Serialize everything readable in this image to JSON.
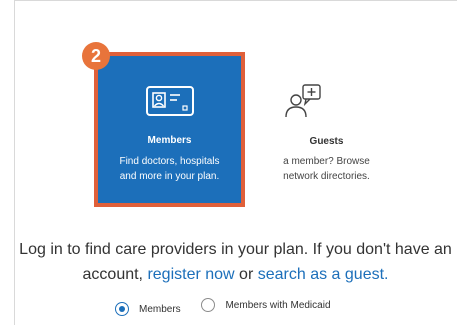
{
  "step_badge": "2",
  "cards": {
    "members": {
      "icon": "id-card-icon",
      "title": "Members",
      "desc_line1": "Find doctors, hospitals",
      "desc_line2": "and more in your plan."
    },
    "guests": {
      "icon": "guest-help-icon",
      "title": "Guests",
      "desc_line1": "a member? Browse",
      "desc_line2": "network directories."
    }
  },
  "login_message": {
    "text1": "Log in to find care providers in your plan. If you don't have an account, ",
    "link_register": "register now",
    "text2": " or ",
    "link_guest": "search as a guest."
  },
  "member_type": {
    "options": [
      {
        "label": "Members",
        "selected": true
      },
      {
        "label": "Members with Medicaid",
        "selected": false
      }
    ]
  },
  "colors": {
    "accent_blue": "#1c6fba",
    "highlight_orange": "#e0603a",
    "badge_orange": "#e8743b"
  }
}
